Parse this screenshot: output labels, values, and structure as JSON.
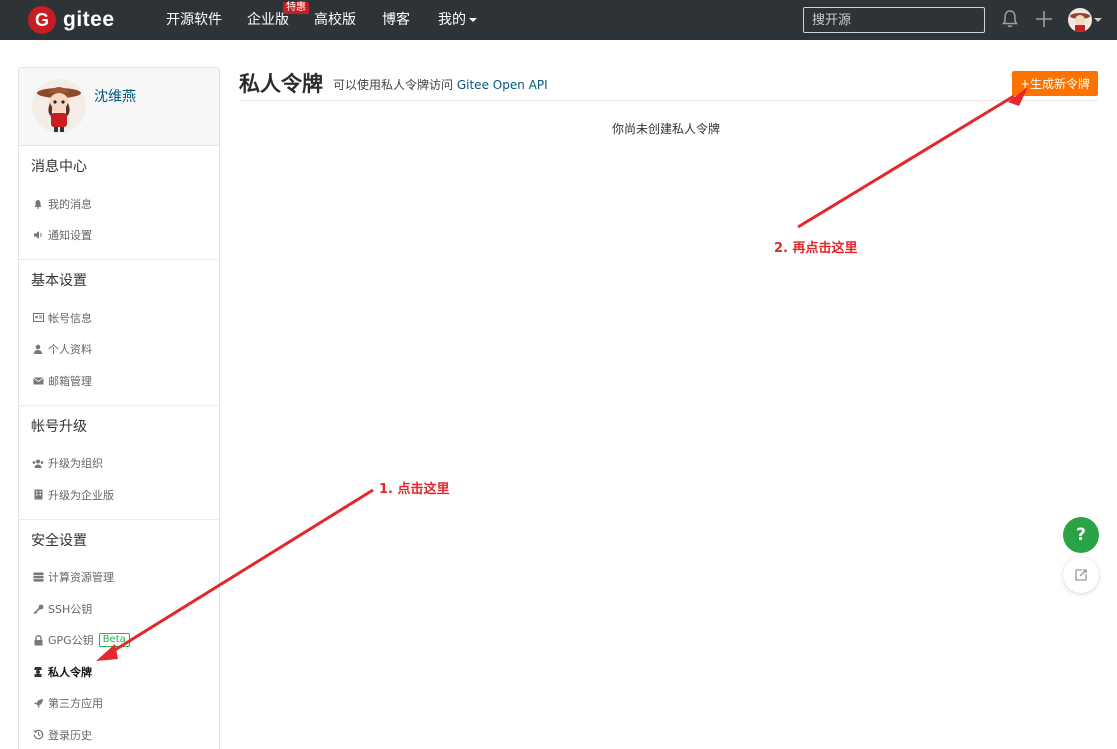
{
  "nav": {
    "logo_text": "gitee",
    "items": [
      "开源软件",
      "企业版",
      "高校版",
      "博客",
      "我的"
    ],
    "badge": "特惠",
    "search_placeholder": "搜开源"
  },
  "sidebar": {
    "username": "沈维燕",
    "sections": [
      {
        "title": "消息中心",
        "items": [
          {
            "icon": "bell-icon",
            "label": "我的消息"
          },
          {
            "icon": "speaker-icon",
            "label": "通知设置"
          }
        ]
      },
      {
        "title": "基本设置",
        "items": [
          {
            "icon": "id-card-icon",
            "label": "帐号信息"
          },
          {
            "icon": "user-icon",
            "label": "个人资料"
          },
          {
            "icon": "envelope-icon",
            "label": "邮箱管理"
          }
        ]
      },
      {
        "title": "帐号升级",
        "items": [
          {
            "icon": "users-icon",
            "label": "升级为组织"
          },
          {
            "icon": "building-icon",
            "label": "升级为企业版"
          }
        ]
      },
      {
        "title": "安全设置",
        "items": [
          {
            "icon": "server-icon",
            "label": "计算资源管理"
          },
          {
            "icon": "key-icon",
            "label": "SSH公钥"
          },
          {
            "icon": "lock-icon",
            "label": "GPG公钥",
            "badge": "Beta"
          },
          {
            "icon": "token-icon",
            "label": "私人令牌"
          },
          {
            "icon": "rocket-icon",
            "label": "第三方应用"
          },
          {
            "icon": "history-icon",
            "label": "登录历史"
          }
        ]
      }
    ]
  },
  "main": {
    "title": "私人令牌",
    "subtitle": "可以使用私人令牌访问",
    "subtitle_link": "Gitee Open API",
    "generate_button": "+生成新令牌",
    "empty_message": "你尚未创建私人令牌"
  },
  "annotations": {
    "step1": "1. 点击这里",
    "step2": "2. 再点击这里"
  },
  "floating": {
    "help_label": "?"
  },
  "colors": {
    "navbar": "#2e3338",
    "brand": "#c71d23",
    "accent_orange": "#fe7300",
    "link": "#005980",
    "annotation": "#e5262b",
    "help_green": "#2ba245"
  }
}
